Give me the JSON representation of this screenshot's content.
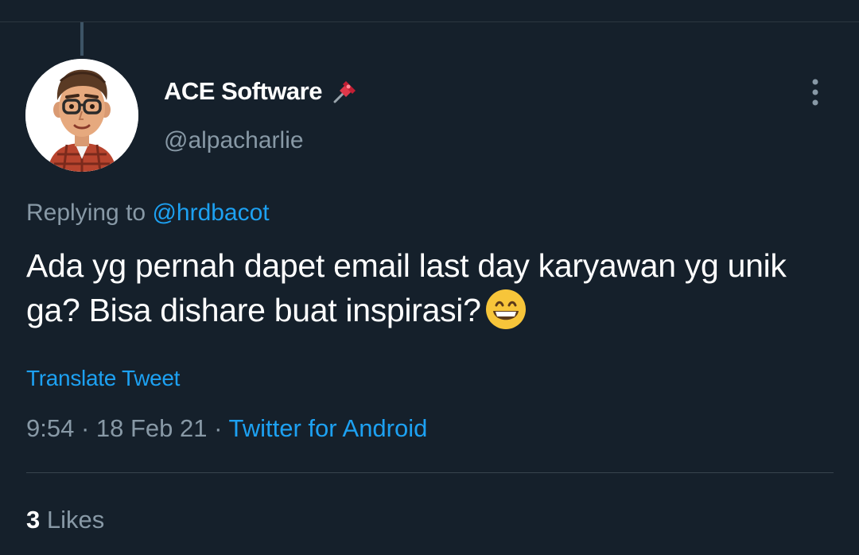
{
  "tweet": {
    "display_name": "ACE Software",
    "name_emoji_icon": "pushpin-icon",
    "handle": "@alpacharlie",
    "replying_prefix": "Replying to",
    "replying_to": "@hrdbacot",
    "text": "Ada yg pernah dapet email last day karyawan yg unik ga? Bisa dishare buat inspirasi?",
    "text_emoji_icon": "grinning-face-icon",
    "translate_label": "Translate Tweet",
    "time": "9:54",
    "date": "18 Feb 21",
    "source": "Twitter for Android",
    "likes_count": "3",
    "likes_label": "Likes"
  },
  "colors": {
    "background": "#15202b",
    "text_primary": "#ffffff",
    "text_secondary": "#8899a6",
    "link": "#1da1f2",
    "divider": "#38444d"
  }
}
